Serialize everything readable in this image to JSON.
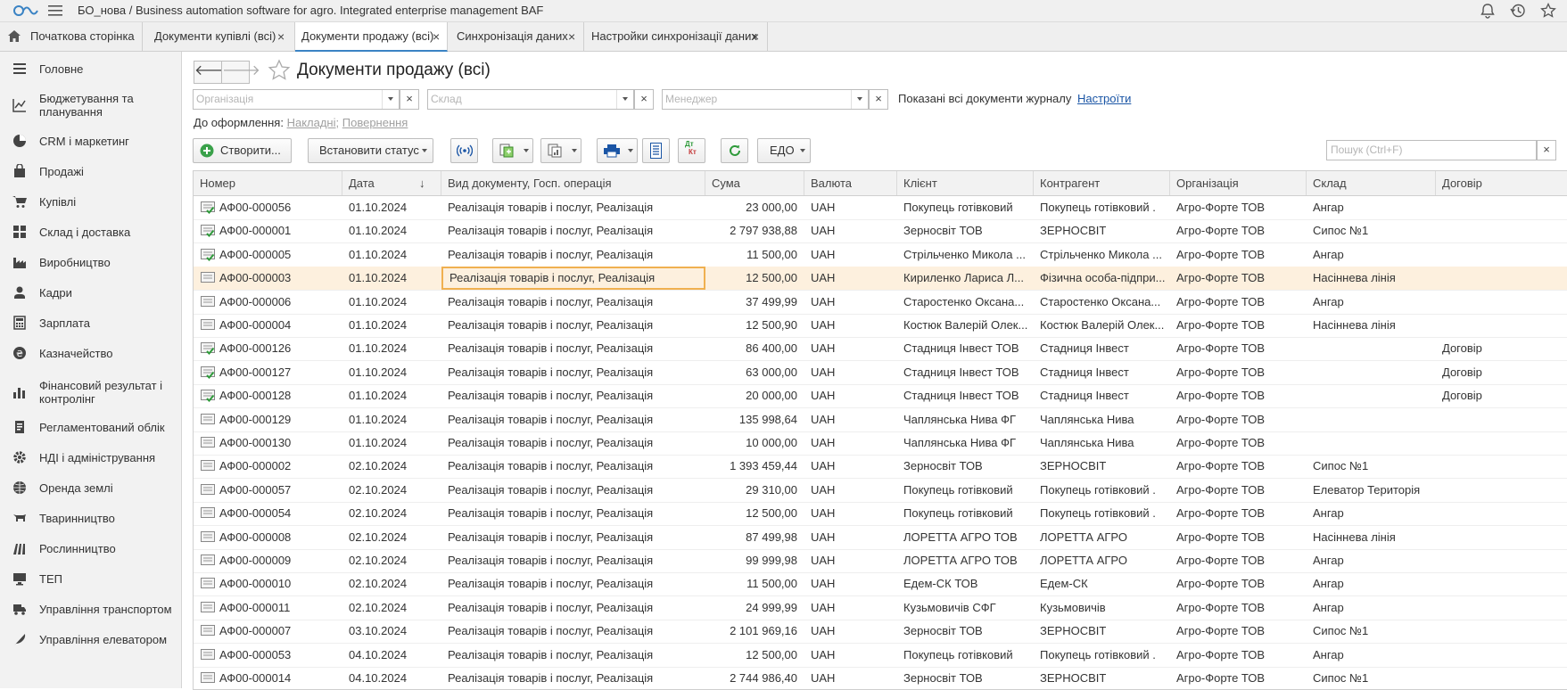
{
  "app": {
    "title": "БО_нова / Business automation software for agro. Integrated enterprise management BAF"
  },
  "tabs": [
    {
      "label": "Початкова сторінка",
      "closable": false
    },
    {
      "label": "Документи купівлі (всі)",
      "closable": true
    },
    {
      "label": "Документи продажу (всі)",
      "closable": true,
      "active": true
    },
    {
      "label": "Синхронізація даних",
      "closable": true
    },
    {
      "label": "Настройки синхронізації даних",
      "closable": true
    }
  ],
  "tab_close": "×",
  "sidebar": {
    "items": [
      {
        "label": "Головне",
        "icon": "menu-lines-icon"
      },
      {
        "label": "Бюджетування та планування",
        "icon": "chart-line-icon"
      },
      {
        "label": "CRM і маркетинг",
        "icon": "pie-chart-icon"
      },
      {
        "label": "Продажі",
        "icon": "shopping-bag-icon"
      },
      {
        "label": "Купівлі",
        "icon": "cart-icon"
      },
      {
        "label": "Склад і доставка",
        "icon": "warehouse-icon"
      },
      {
        "label": "Виробництво",
        "icon": "factory-icon"
      },
      {
        "label": "Кадри",
        "icon": "person-icon"
      },
      {
        "label": "Зарплата",
        "icon": "calculator-icon"
      },
      {
        "label": "Казначейство",
        "icon": "treasury-icon"
      },
      {
        "label": "Фінансовий результат і контролінг",
        "icon": "bar-chart-icon"
      },
      {
        "label": "Регламентований облік",
        "icon": "ledger-icon"
      },
      {
        "label": "НДІ і адміністрування",
        "icon": "gear-icon"
      },
      {
        "label": "Оренда землі",
        "icon": "globe-icon"
      },
      {
        "label": "Тваринництво",
        "icon": "cow-icon"
      },
      {
        "label": "Рослинництво",
        "icon": "field-icon"
      },
      {
        "label": "ТЕП",
        "icon": "monitor-icon"
      },
      {
        "label": "Управління транспортом",
        "icon": "truck-icon"
      },
      {
        "label": "Управління елеватором",
        "icon": "feather-icon"
      }
    ]
  },
  "page": {
    "title": "Документи продажу (всі)",
    "back": "🡐",
    "forward": "🡒",
    "filters": {
      "organization_placeholder": "Організація",
      "warehouse_placeholder": "Склад",
      "manager_placeholder": "Менеджер",
      "clear": "×"
    },
    "info_text": "Показані всі документи журналу",
    "settings_link": "Настроїти",
    "to_process_label": "До оформлення:",
    "to_process_invoices": "Накладні",
    "to_process_sep": ";",
    "to_process_returns": "Повернення"
  },
  "toolbar": {
    "create": "Створити...",
    "set_status": "Встановити статус",
    "edo": "ЕДО",
    "dtkt_top": "Дт",
    "dtkt_bottom": "Кт",
    "search_placeholder": "Пошук (Ctrl+F)",
    "search_clear": "×"
  },
  "table": {
    "columns": [
      "Номер",
      "Дата",
      "Вид документу, Госп. операція",
      "Сума",
      "Валюта",
      "Клієнт",
      "Контрагент",
      "Організація",
      "Склад",
      "Договір"
    ],
    "sort_indicator": "↓",
    "rows": [
      {
        "posted": true,
        "num": "АФ00-000056",
        "date": "01.10.2024",
        "kind": "Реалізація товарів і послуг, Реалізація",
        "sum": "23 000,00",
        "cur": "UAH",
        "client": "Покупець готівковий",
        "counterparty": "Покупець готівковий .",
        "org": "Агро-Форте ТОВ",
        "wh": "Ангар",
        "contract": ""
      },
      {
        "posted": true,
        "num": "АФ00-000001",
        "date": "01.10.2024",
        "kind": "Реалізація товарів і послуг, Реалізація",
        "sum": "2 797 938,88",
        "cur": "UAH",
        "client": "Зерносвіт ТОВ",
        "counterparty": "ЗЕРНОСВІТ",
        "org": "Агро-Форте ТОВ",
        "wh": "Сипос №1",
        "contract": ""
      },
      {
        "posted": true,
        "num": "АФ00-000005",
        "date": "01.10.2024",
        "kind": "Реалізація товарів і послуг, Реалізація",
        "sum": "11 500,00",
        "cur": "UAH",
        "client": "Стрільченко Микола ...",
        "counterparty": "Стрільченко Микола ...",
        "org": "Агро-Форте ТОВ",
        "wh": "Ангар",
        "contract": ""
      },
      {
        "posted": false,
        "selected": true,
        "num": "АФ00-000003",
        "date": "01.10.2024",
        "kind": "Реалізація товарів і послуг, Реалізація",
        "sum": "12 500,00",
        "cur": "UAH",
        "client": "Кириленко Лариса Л...",
        "counterparty": "Фізична особа-підпри...",
        "org": "Агро-Форте ТОВ",
        "wh": "Насіннева лінія",
        "contract": ""
      },
      {
        "posted": false,
        "num": "АФ00-000006",
        "date": "01.10.2024",
        "kind": "Реалізація товарів і послуг, Реалізація",
        "sum": "37 499,99",
        "cur": "UAH",
        "client": "Старостенко Оксана...",
        "counterparty": "Старостенко Оксана...",
        "org": "Агро-Форте ТОВ",
        "wh": "Ангар",
        "contract": ""
      },
      {
        "posted": false,
        "num": "АФ00-000004",
        "date": "01.10.2024",
        "kind": "Реалізація товарів і послуг, Реалізація",
        "sum": "12 500,90",
        "cur": "UAH",
        "client": "Костюк Валерій Олек...",
        "counterparty": "Костюк Валерій Олек...",
        "org": "Агро-Форте ТОВ",
        "wh": "Насіннева лінія",
        "contract": ""
      },
      {
        "posted": true,
        "num": "АФ00-000126",
        "date": "01.10.2024",
        "kind": "Реалізація товарів і послуг, Реалізація",
        "sum": "86 400,00",
        "cur": "UAH",
        "client": "Стадниця Інвест ТОВ",
        "counterparty": "Стадниця Інвест",
        "org": "Агро-Форте ТОВ",
        "wh": "",
        "contract": "Договір"
      },
      {
        "posted": true,
        "num": "АФ00-000127",
        "date": "01.10.2024",
        "kind": "Реалізація товарів і послуг, Реалізація",
        "sum": "63 000,00",
        "cur": "UAH",
        "client": "Стадниця Інвест ТОВ",
        "counterparty": "Стадниця Інвест",
        "org": "Агро-Форте ТОВ",
        "wh": "",
        "contract": "Договір"
      },
      {
        "posted": true,
        "num": "АФ00-000128",
        "date": "01.10.2024",
        "kind": "Реалізація товарів і послуг, Реалізація",
        "sum": "20 000,00",
        "cur": "UAH",
        "client": "Стадниця Інвест ТОВ",
        "counterparty": "Стадниця Інвест",
        "org": "Агро-Форте ТОВ",
        "wh": "",
        "contract": "Договір"
      },
      {
        "posted": false,
        "num": "АФ00-000129",
        "date": "01.10.2024",
        "kind": "Реалізація товарів і послуг, Реалізація",
        "sum": "135 998,64",
        "cur": "UAH",
        "client": "Чаплянська Нива ФГ",
        "counterparty": "Чаплянська Нива",
        "org": "Агро-Форте ТОВ",
        "wh": "",
        "contract": ""
      },
      {
        "posted": false,
        "num": "АФ00-000130",
        "date": "01.10.2024",
        "kind": "Реалізація товарів і послуг, Реалізація",
        "sum": "10 000,00",
        "cur": "UAH",
        "client": "Чаплянська Нива ФГ",
        "counterparty": "Чаплянська Нива",
        "org": "Агро-Форте ТОВ",
        "wh": "",
        "contract": ""
      },
      {
        "posted": false,
        "num": "АФ00-000002",
        "date": "02.10.2024",
        "kind": "Реалізація товарів і послуг, Реалізація",
        "sum": "1 393 459,44",
        "cur": "UAH",
        "client": "Зерносвіт ТОВ",
        "counterparty": "ЗЕРНОСВІТ",
        "org": "Агро-Форте ТОВ",
        "wh": "Сипос №1",
        "contract": ""
      },
      {
        "posted": false,
        "num": "АФ00-000057",
        "date": "02.10.2024",
        "kind": "Реалізація товарів і послуг, Реалізація",
        "sum": "29 310,00",
        "cur": "UAH",
        "client": "Покупець готівковий",
        "counterparty": "Покупець готівковий .",
        "org": "Агро-Форте ТОВ",
        "wh": "Елеватор Територія",
        "contract": ""
      },
      {
        "posted": false,
        "num": "АФ00-000054",
        "date": "02.10.2024",
        "kind": "Реалізація товарів і послуг, Реалізація",
        "sum": "12 500,00",
        "cur": "UAH",
        "client": "Покупець готівковий",
        "counterparty": "Покупець готівковий .",
        "org": "Агро-Форте ТОВ",
        "wh": "Ангар",
        "contract": ""
      },
      {
        "posted": false,
        "num": "АФ00-000008",
        "date": "02.10.2024",
        "kind": "Реалізація товарів і послуг, Реалізація",
        "sum": "87 499,98",
        "cur": "UAH",
        "client": "ЛОРЕТТА АГРО ТОВ",
        "counterparty": "ЛОРЕТТА АГРО",
        "org": "Агро-Форте ТОВ",
        "wh": "Насіннева лінія",
        "contract": ""
      },
      {
        "posted": false,
        "num": "АФ00-000009",
        "date": "02.10.2024",
        "kind": "Реалізація товарів і послуг, Реалізація",
        "sum": "99 999,98",
        "cur": "UAH",
        "client": "ЛОРЕТТА АГРО ТОВ",
        "counterparty": "ЛОРЕТТА АГРО",
        "org": "Агро-Форте ТОВ",
        "wh": "Ангар",
        "contract": ""
      },
      {
        "posted": false,
        "num": "АФ00-000010",
        "date": "02.10.2024",
        "kind": "Реалізація товарів і послуг, Реалізація",
        "sum": "11 500,00",
        "cur": "UAH",
        "client": "Едем-СК ТОВ",
        "counterparty": "Едем-СК",
        "org": "Агро-Форте ТОВ",
        "wh": "Ангар",
        "contract": ""
      },
      {
        "posted": false,
        "num": "АФ00-000011",
        "date": "02.10.2024",
        "kind": "Реалізація товарів і послуг, Реалізація",
        "sum": "24 999,99",
        "cur": "UAH",
        "client": "Кузьмовичів СФГ",
        "counterparty": "Кузьмовичів",
        "org": "Агро-Форте ТОВ",
        "wh": "Ангар",
        "contract": ""
      },
      {
        "posted": false,
        "num": "АФ00-000007",
        "date": "03.10.2024",
        "kind": "Реалізація товарів і послуг, Реалізація",
        "sum": "2 101 969,16",
        "cur": "UAH",
        "client": "Зерносвіт ТОВ",
        "counterparty": "ЗЕРНОСВІТ",
        "org": "Агро-Форте ТОВ",
        "wh": "Сипос №1",
        "contract": ""
      },
      {
        "posted": false,
        "num": "АФ00-000053",
        "date": "04.10.2024",
        "kind": "Реалізація товарів і послуг, Реалізація",
        "sum": "12 500,00",
        "cur": "UAH",
        "client": "Покупець готівковий",
        "counterparty": "Покупець готівковий .",
        "org": "Агро-Форте ТОВ",
        "wh": "Ангар",
        "contract": ""
      },
      {
        "posted": false,
        "num": "АФ00-000014",
        "date": "04.10.2024",
        "kind": "Реалізація товарів і послуг, Реалізація",
        "sum": "2 744 986,40",
        "cur": "UAH",
        "client": "Зерносвіт ТОВ",
        "counterparty": "ЗЕРНОСВІТ",
        "org": "Агро-Форте ТОВ",
        "wh": "Сипос №1",
        "contract": ""
      }
    ]
  },
  "colors": {
    "accent": "#3a83c4",
    "selected_row": "#fdf0de",
    "focus_border": "#f0b050",
    "posted_check": "#2e9a3a"
  }
}
